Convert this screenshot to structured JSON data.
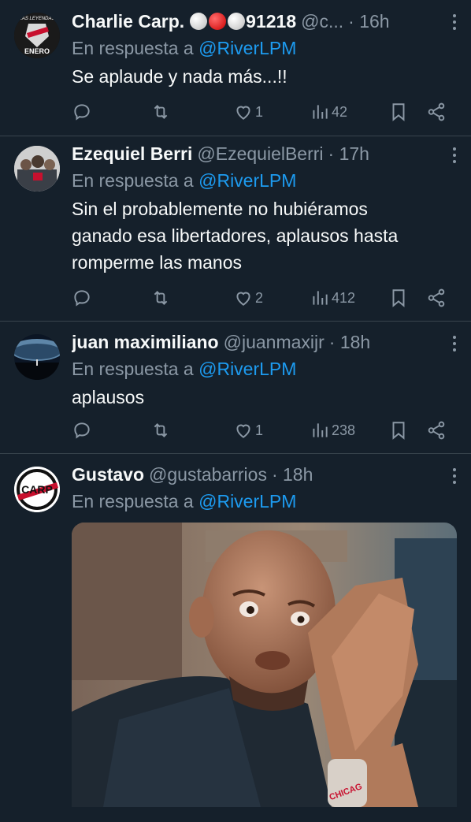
{
  "tweets": [
    {
      "name": "Charlie Carp.",
      "name_suffix": "91218",
      "handle": "@c...",
      "time": "· 16h",
      "reply_prefix": "En respuesta a",
      "reply_to": "@RiverLPM",
      "text": "Se aplaude y nada más...!!",
      "likes": "1",
      "views": "42",
      "avatar_text_top": "LAS LEYENDAS",
      "avatar_text_bottom": "ENERO"
    },
    {
      "name": "Ezequiel Berri",
      "handle": "@EzequielBerri",
      "time": "· 17h",
      "reply_prefix": "En respuesta a",
      "reply_to": "@RiverLPM",
      "text_lines": [
        "Sin el probablemente no hubiéramos",
        "ganado esa libertadores, aplausos hasta",
        "romperme las manos"
      ],
      "likes": "2",
      "views": "412"
    },
    {
      "name": "juan maximiliano",
      "handle": "@juanmaxijr",
      "time": "· 18h",
      "reply_prefix": "En respuesta a",
      "reply_to": "@RiverLPM",
      "text": "aplausos",
      "likes": "1",
      "views": "238"
    },
    {
      "name": "Gustavo",
      "handle": "@gustabarrios",
      "time": "· 18h",
      "reply_prefix": "En respuesta a",
      "reply_to": "@RiverLPM",
      "avatar_logo": "CARP",
      "media_caption": "CHICAG"
    }
  ],
  "icons": {
    "reply": "reply-icon",
    "retweet": "retweet-icon",
    "like": "heart-icon",
    "views": "views-icon",
    "bookmark": "bookmark-icon",
    "share": "share-icon",
    "more": "more-dots-icon"
  },
  "colors": {
    "background": "#15202b",
    "secondary_text": "#8b98a5",
    "link": "#1d9bf0",
    "divider": "#38444d"
  }
}
